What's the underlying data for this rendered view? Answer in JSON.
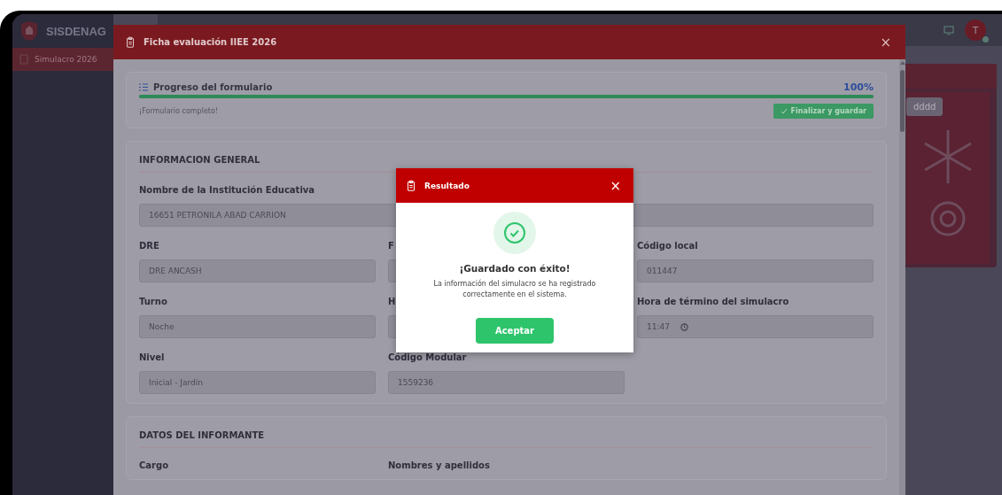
{
  "app": {
    "brand": "SISDENAG",
    "sidebar": {
      "items": [
        {
          "label": "Simulacro 2026",
          "selected": true
        }
      ]
    },
    "topbar": {
      "avatar": "T"
    },
    "background_card": {
      "button": "dddd"
    }
  },
  "modal": {
    "title": "Ficha evaluación IIEE 2026",
    "close": "×",
    "progress": {
      "title": "Progreso del formulario",
      "percent": "100%",
      "level": 1,
      "status": "¡Formulario completo!",
      "button": "Finalizar y guardar"
    },
    "sections": [
      {
        "title": "INFORMACION GENERAL",
        "fields": [
          {
            "label": "Nombre de la Institución Educativa",
            "value": "16651 PETRONILA ABAD CARRION",
            "kind": "wide"
          },
          {
            "label": "DRE",
            "value": "DRE ANCASH",
            "kind": "text"
          },
          {
            "label": "F",
            "kind": "text"
          },
          {
            "label": "Código local",
            "value": "011447",
            "kind": "text"
          },
          {
            "label": "Turno",
            "value": "Noche",
            "kind": "text"
          },
          {
            "label": "H",
            "kind": "text"
          },
          {
            "label": "Hora de término del simulacro",
            "value": "11:47",
            "kind": "time"
          },
          {
            "label": "Nivel",
            "value": "Inicial - Jardín",
            "kind": "text"
          },
          {
            "label": "Código Modular",
            "value": "1559236",
            "kind": "text"
          }
        ]
      },
      {
        "title": "DATOS DEL INFORMANTE",
        "fields": [
          {
            "label": "Cargo",
            "kind": "label"
          },
          {
            "label": "Nombres y apellidos",
            "kind": "label"
          }
        ]
      }
    ]
  },
  "dialog": {
    "title": "Resultado",
    "close": "×",
    "heading": "¡Guardado con éxito!",
    "message": "La información del simulacro se ha registrado correctamente en el sistema.",
    "button": "Aceptar"
  }
}
